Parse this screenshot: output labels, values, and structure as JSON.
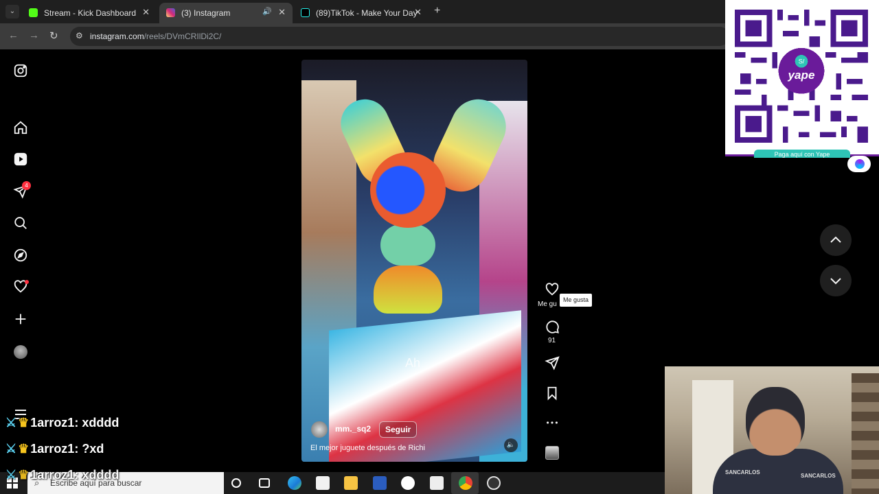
{
  "browser": {
    "tabs": [
      {
        "title": "Stream - Kick Dashboard",
        "icon": "kick-icon"
      },
      {
        "title": "(3) Instagram",
        "icon": "instagram-icon",
        "active": true,
        "audio": true
      },
      {
        "title": "(89)TikTok - Make Your Day",
        "icon": "tiktok-icon"
      }
    ],
    "url_host": "instagram.com",
    "url_path": "/reels/DVmCRIlDi2C/",
    "new_tab": "+"
  },
  "sidebar": {
    "icons": [
      "instagram-logo-icon",
      "home-icon",
      "reels-icon",
      "messages-icon",
      "search-icon",
      "explore-icon",
      "notifications-icon",
      "create-icon",
      "profile-avatar",
      "menu-icon"
    ],
    "messages_badge": "4"
  },
  "reel": {
    "overlay_text": "Ah",
    "username": "mm._sq2",
    "follow_label": "Seguir",
    "caption": "El mejor juguete después de Richi"
  },
  "actions": {
    "like_label": "Me gu",
    "like_tooltip": "Me gusta",
    "comments_count": "91"
  },
  "qr": {
    "brand": "yape",
    "currency": "S/",
    "caption": "Paga aquí con Yape"
  },
  "chat": [
    {
      "user": "1arroz1",
      "message": "xdddd"
    },
    {
      "user": "1arroz1",
      "message": "?xd"
    },
    {
      "user": "1arroz1",
      "message": "xdddd"
    }
  ],
  "webcam": {
    "shirt_logo": "SANCARLOS"
  },
  "taskbar": {
    "search_placeholder": "Escribe aquí para buscar"
  },
  "colors": {
    "instagram_bg": "#000000",
    "like_badge": "#ff3040",
    "yape_purple": "#6a1b9a",
    "yape_teal": "#2ec4b6"
  }
}
